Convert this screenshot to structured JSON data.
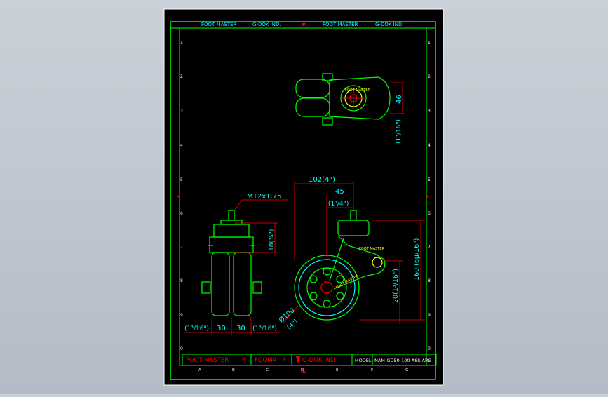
{
  "sheet": {
    "header_left": "FOOT MASTER",
    "header_left2": "G-DOK IND.",
    "header_right": "FOOT MASTER",
    "header_right2": "G-DOK IND.",
    "row_numbers": [
      "1",
      "2",
      "3",
      "4",
      "5",
      "6",
      "7",
      "8",
      "9",
      "0"
    ],
    "col_letters": [
      "A",
      "B",
      "C",
      "D",
      "E",
      "F",
      "G"
    ]
  },
  "title_block": {
    "brand1": "FOOT MASTER",
    "brand2": "FOOMA",
    "brand3": "G-DOK IND.",
    "model_label": "MODEL",
    "model_value": "NAM-GD50-100-ASS.ARS"
  },
  "dimensions": {
    "top_view_height": "46",
    "top_view_height_in": "(1³/16\")",
    "thread": "M12x1.75",
    "stem_length_in": "18(¾\")",
    "overall_offset": "102(4\")",
    "swivel_offset": "45",
    "swivel_offset_in": "(1³/4\")",
    "total_height": "160 (6µ/16\")",
    "axle_height": "20(1³/16\")",
    "wheel_dia": "Ø100",
    "wheel_dia_in": "(4\")",
    "width_left_in": "(1³/16\")",
    "width_a": "30",
    "width_b": "30",
    "width_right_in": "(1³/16\")"
  },
  "labels": {
    "wheel_brand": "FOOT MASTER",
    "fork_brand": "FOOT MASTER"
  },
  "colors": {
    "canvas": "#000000",
    "border": "#00ff00",
    "part": "#00ff00",
    "dimension": "#ff0000",
    "text": "#00ffff",
    "accent": "#ffff00"
  }
}
